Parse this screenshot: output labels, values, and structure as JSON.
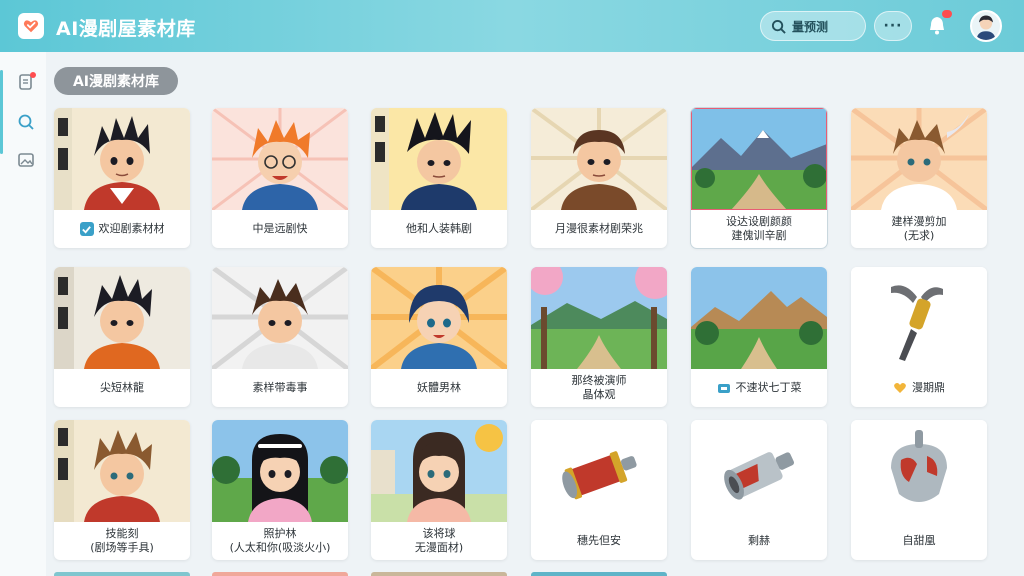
{
  "app": {
    "title": "AI漫剧屋素材库",
    "search_label": "量预测",
    "more_label": "···"
  },
  "section": {
    "title": "AI漫剧素材库"
  },
  "colors": {
    "accent": "#5cc7d6",
    "badge": "#ff4d4f",
    "check": "#3aa0c8"
  },
  "sidebar": {
    "items": [
      {
        "icon": "document-icon"
      },
      {
        "icon": "search-icon"
      },
      {
        "icon": "image-icon"
      }
    ]
  },
  "cards": [
    {
      "caption": "欢迎剧素材材",
      "checked": true
    },
    {
      "caption": "中是远剧快"
    },
    {
      "caption": "他和人装韩剧"
    },
    {
      "caption": "月漫很素材剧荣兆"
    },
    {
      "caption": "设达设剧颜颜",
      "caption2": "建傀训辛剧"
    },
    {
      "caption": "建样漫剪加",
      "caption2": "(无求)"
    },
    {
      "caption": "尖短林龍"
    },
    {
      "caption": "素样带毒事"
    },
    {
      "caption": "妖體男林"
    },
    {
      "caption": "那终被演师",
      "caption2": "晶体观"
    },
    {
      "caption": "不速状七丁菜"
    },
    {
      "caption": "漫期鼎"
    },
    {
      "caption": "技能刻",
      "caption2": "(剧场等手具)"
    },
    {
      "caption": "照护林",
      "caption2": "(人太和你(吸淡火小)"
    },
    {
      "caption": "该将球",
      "caption2": "无漫面材)"
    },
    {
      "caption": "穗先但安"
    },
    {
      "caption": "剩赫"
    },
    {
      "caption": "自甜凰"
    }
  ]
}
